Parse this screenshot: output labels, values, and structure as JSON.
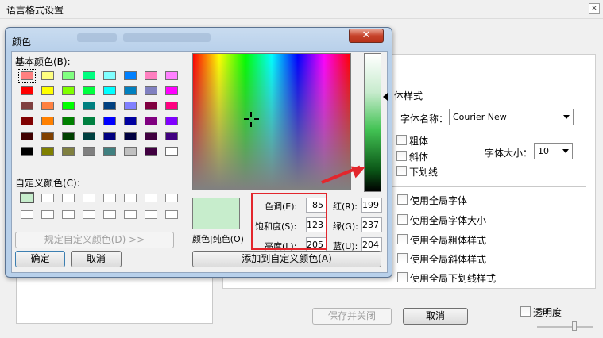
{
  "window": {
    "title": "语言格式设置",
    "close_glyph": "×"
  },
  "font_group": {
    "title": "体样式",
    "font_name_label": "字体名称：",
    "font_name_value": "Courier New",
    "bold": "粗体",
    "italic": "斜体",
    "underline": "下划线",
    "font_size_label": "字体大小：",
    "font_size_value": "10"
  },
  "global_options": [
    "使用全局字体",
    "使用全局字体大小",
    "使用全局粗体样式",
    "使用全局斜体样式",
    "使用全局下划线样式"
  ],
  "bottom": {
    "save_close": "保存并关闭",
    "cancel": "取消",
    "transparency": "透明度"
  },
  "color_dialog": {
    "title": "颜色",
    "close_glyph": "✕",
    "basic_colors_label": "基本颜色(B):",
    "custom_colors_label": "自定义颜色(C):",
    "define_custom_button": "规定自定义颜色(D) >>",
    "ok_button": "确定",
    "cancel_button": "取消",
    "color_solid_label": "颜色|纯色(O)",
    "add_to_custom_button": "添加到自定义颜色(A)",
    "fields": {
      "hue": {
        "label": "色调(E):",
        "value": "85"
      },
      "sat": {
        "label": "饱和度(S):",
        "value": "123"
      },
      "lum": {
        "label": "亮度(L):",
        "value": "205"
      },
      "red": {
        "label": "红(R):",
        "value": "199"
      },
      "green": {
        "label": "绿(G):",
        "value": "237"
      },
      "blue": {
        "label": "蓝(U):",
        "value": "204"
      }
    },
    "selected_color": "#c7edcc",
    "basic_colors": [
      "#ff8080",
      "#ffff80",
      "#80ff80",
      "#00ff80",
      "#80ffff",
      "#0080ff",
      "#ff80c0",
      "#ff80ff",
      "#ff0000",
      "#ffff00",
      "#80ff00",
      "#00ff40",
      "#00ffff",
      "#0080c0",
      "#8080c0",
      "#ff00ff",
      "#804040",
      "#ff8040",
      "#00ff00",
      "#008080",
      "#004080",
      "#8080ff",
      "#800040",
      "#ff0080",
      "#800000",
      "#ff8000",
      "#008000",
      "#008040",
      "#0000ff",
      "#0000a0",
      "#800080",
      "#8000ff",
      "#400000",
      "#804000",
      "#004000",
      "#004040",
      "#000080",
      "#000040",
      "#400040",
      "#400080",
      "#000000",
      "#808000",
      "#808040",
      "#808080",
      "#408080",
      "#c0c0c0",
      "#400040",
      "#ffffff"
    ],
    "custom_colors": [
      "#c7edcc",
      "#ffffff",
      "#ffffff",
      "#ffffff",
      "#ffffff",
      "#ffffff",
      "#ffffff",
      "#ffffff",
      "#ffffff",
      "#ffffff",
      "#ffffff",
      "#ffffff",
      "#ffffff",
      "#ffffff",
      "#ffffff",
      "#ffffff"
    ]
  }
}
